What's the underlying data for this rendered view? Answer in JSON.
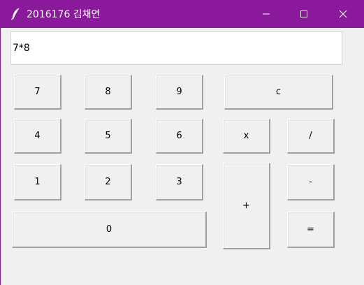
{
  "window": {
    "title": "2016176 김채연",
    "titlebar_color": "#8a1a9b",
    "icon": "feather-icon",
    "controls": {
      "minimize": "minimize-icon",
      "maximize": "maximize-icon",
      "close": "close-icon"
    }
  },
  "display": {
    "value": "7*8"
  },
  "buttons": {
    "seven": "7",
    "eight": "8",
    "nine": "9",
    "clear": "c",
    "four": "4",
    "five": "5",
    "six": "6",
    "multiply": "x",
    "divide": "/",
    "one": "1",
    "two": "2",
    "three": "3",
    "plus": "+",
    "minus": "-",
    "zero": "0",
    "equals": "="
  }
}
